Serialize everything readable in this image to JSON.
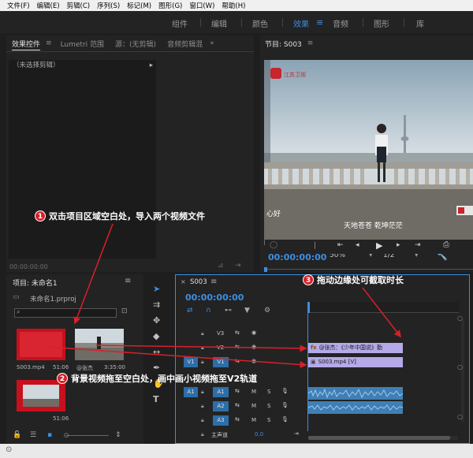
{
  "menu": [
    "文件(F)",
    "编辑(E)",
    "剪辑(C)",
    "序列(S)",
    "标记(M)",
    "图形(G)",
    "窗口(W)",
    "帮助(H)"
  ],
  "workspaces": {
    "items": [
      "组件",
      "编辑",
      "颜色",
      "效果",
      "音频",
      "图形",
      "库"
    ],
    "active": "效果"
  },
  "effect_panel": {
    "tabs": [
      "效果控件",
      "Lumetri 范围",
      "源：(无剪辑)",
      "音频剪辑混"
    ],
    "no_clip": "（未选择剪辑）",
    "timecode": "00:00:00:00"
  },
  "program": {
    "tab": "节目: S003",
    "timecode": "00:00:00:00",
    "zoom": "50%",
    "resolution": "1/2",
    "logo_text": "江苏卫视",
    "caption_left": "心好",
    "caption_main": "天地苍苍 乾坤茫茫"
  },
  "project": {
    "title": "项目: 未命名1",
    "file": "未命名1.prproj",
    "items": [
      {
        "name": "S003.mp4",
        "duration": "51:06"
      },
      {
        "name": "@张杰",
        "duration": "3:35:00"
      },
      {
        "name": "",
        "duration": "51:06"
      }
    ]
  },
  "timeline": {
    "tab": "S003",
    "timecode": "00:00:00:00",
    "tracks": [
      {
        "name": "V3"
      },
      {
        "name": "V2"
      },
      {
        "name": "V1",
        "src": "V1"
      },
      {
        "name": "A1",
        "src": "A1"
      },
      {
        "name": "A2"
      },
      {
        "name": "A3"
      }
    ],
    "master_label": "主声道",
    "master_value": "0.0",
    "clip_v2": "@张杰：《少年中国说》勤",
    "clip_v1": "S003.mp4 [V]"
  },
  "annotations": [
    {
      "num": "1",
      "text": "双击项目区域空白处，导入两个视频文件"
    },
    {
      "num": "2",
      "text": "背景视频拖至空白处，画中画小视频拖至V2轨道"
    },
    {
      "num": "3",
      "text": "拖动边缘处可截取时长"
    }
  ],
  "colors": {
    "accent": "#3d8ee0",
    "annotation_red": "#d8202a",
    "video_clip": "#b5a9e8",
    "audio_clip": "#3f7fb5"
  }
}
